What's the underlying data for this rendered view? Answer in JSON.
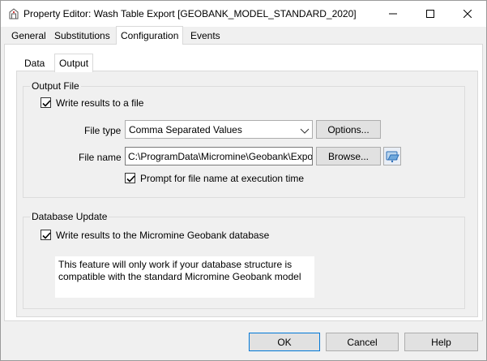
{
  "window": {
    "title": "Property Editor: Wash Table Export [GEOBANK_MODEL_STANDARD_2020]"
  },
  "tabs": [
    {
      "label": "General"
    },
    {
      "label": "Substitutions"
    },
    {
      "label": "Configuration"
    },
    {
      "label": "Events"
    }
  ],
  "subtabs": [
    {
      "label": "Data"
    },
    {
      "label": "Output"
    }
  ],
  "output_file": {
    "group_label": "Output File",
    "write_to_file_label": "Write results to a file",
    "write_to_file_checked": true,
    "file_type_label": "File type",
    "file_type_value": "Comma Separated Values",
    "options_label": "Options...",
    "file_name_label": "File name",
    "file_name_value": "C:\\ProgramData\\Micromine\\Geobank\\Expo",
    "browse_label": "Browse...",
    "prompt_label": "Prompt for file name at execution time",
    "prompt_checked": true
  },
  "database_update": {
    "group_label": "Database Update",
    "write_to_db_label": "Write results to the Micromine Geobank database",
    "write_to_db_checked": true,
    "note_line1": "This feature will only work if your database structure is",
    "note_line2": "compatible with the standard Micromine Geobank model"
  },
  "footer": {
    "ok_label": "OK",
    "cancel_label": "Cancel",
    "help_label": "Help"
  },
  "colors": {
    "accent": "#0078d7",
    "window_bg": "#f0f0f0"
  }
}
